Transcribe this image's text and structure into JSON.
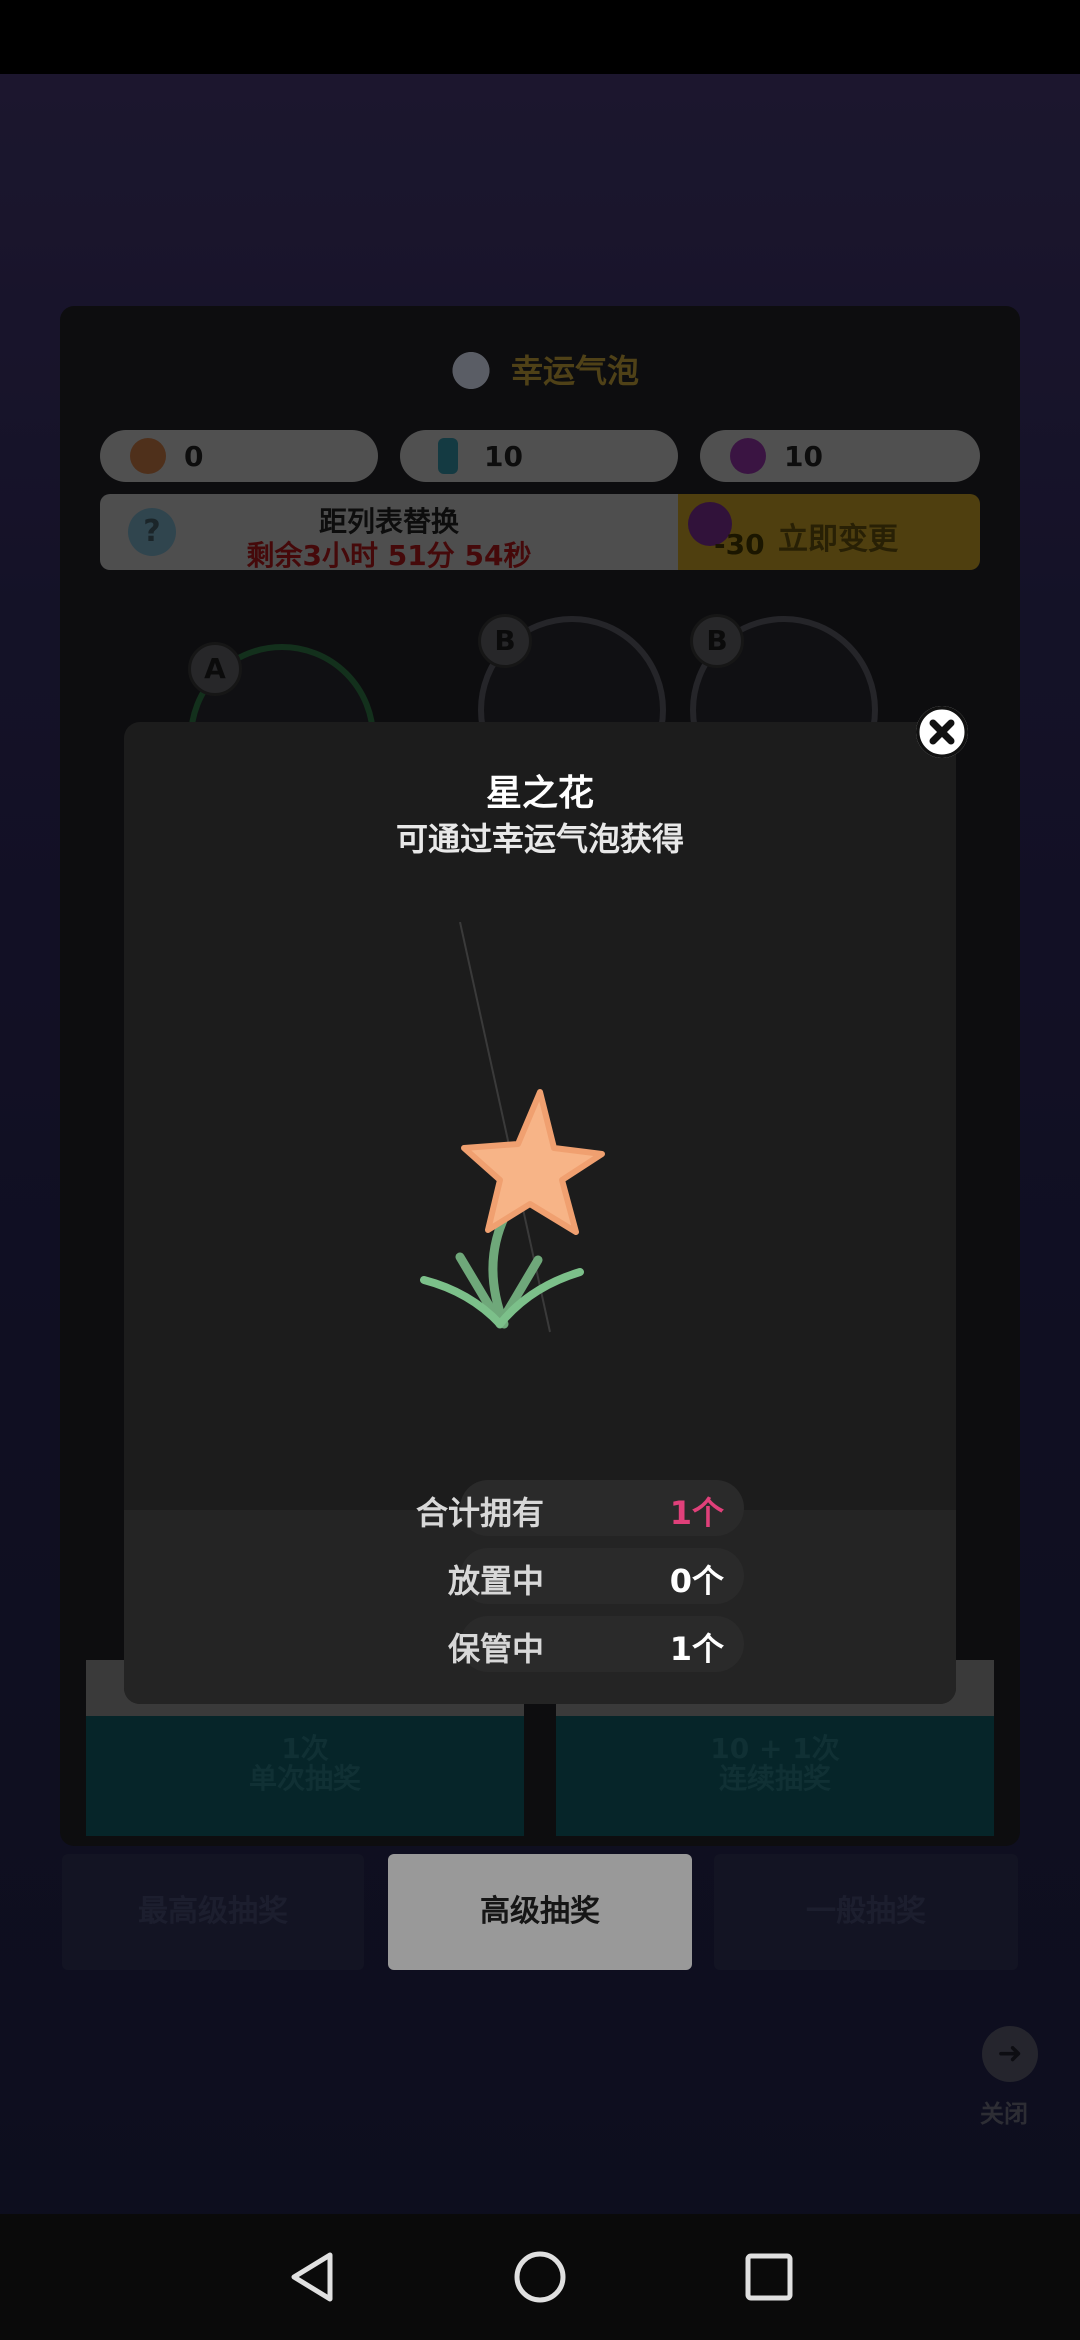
{
  "background": {
    "panel_title": "幸运气泡",
    "resources": [
      {
        "icon": "gourd-icon",
        "value": "0"
      },
      {
        "icon": "potion-bottle-icon",
        "value": "10"
      },
      {
        "icon": "purple-gem-icon",
        "value": "10"
      }
    ],
    "timer": {
      "title": "距列表替换",
      "remaining": "剩余3小时 51分 54秒"
    },
    "change_button": {
      "cost": "-30",
      "label": "立即变更"
    },
    "bubbles": [
      {
        "tag": "A"
      },
      {
        "tag": "B"
      },
      {
        "tag": "B"
      }
    ],
    "draw_buttons": [
      {
        "line1": "1次",
        "line2": "单次抽奖"
      },
      {
        "line1": "10 + 1次",
        "line2": "连续抽奖"
      }
    ],
    "tabs": [
      "最高级抽奖",
      "高级抽奖",
      "一般抽奖"
    ],
    "close_label": "关闭"
  },
  "modal": {
    "title": "星之花",
    "subtitle": "可通过幸运气泡获得",
    "stats": [
      {
        "label": "合计拥有",
        "value": "1个"
      },
      {
        "label": "放置中",
        "value": "0个"
      },
      {
        "label": "保管中",
        "value": "1个"
      }
    ],
    "highlight_color": "#e0407a"
  },
  "navigation": {
    "back": "back-triangle-icon",
    "home": "home-circle-icon",
    "recents": "recents-square-icon"
  }
}
